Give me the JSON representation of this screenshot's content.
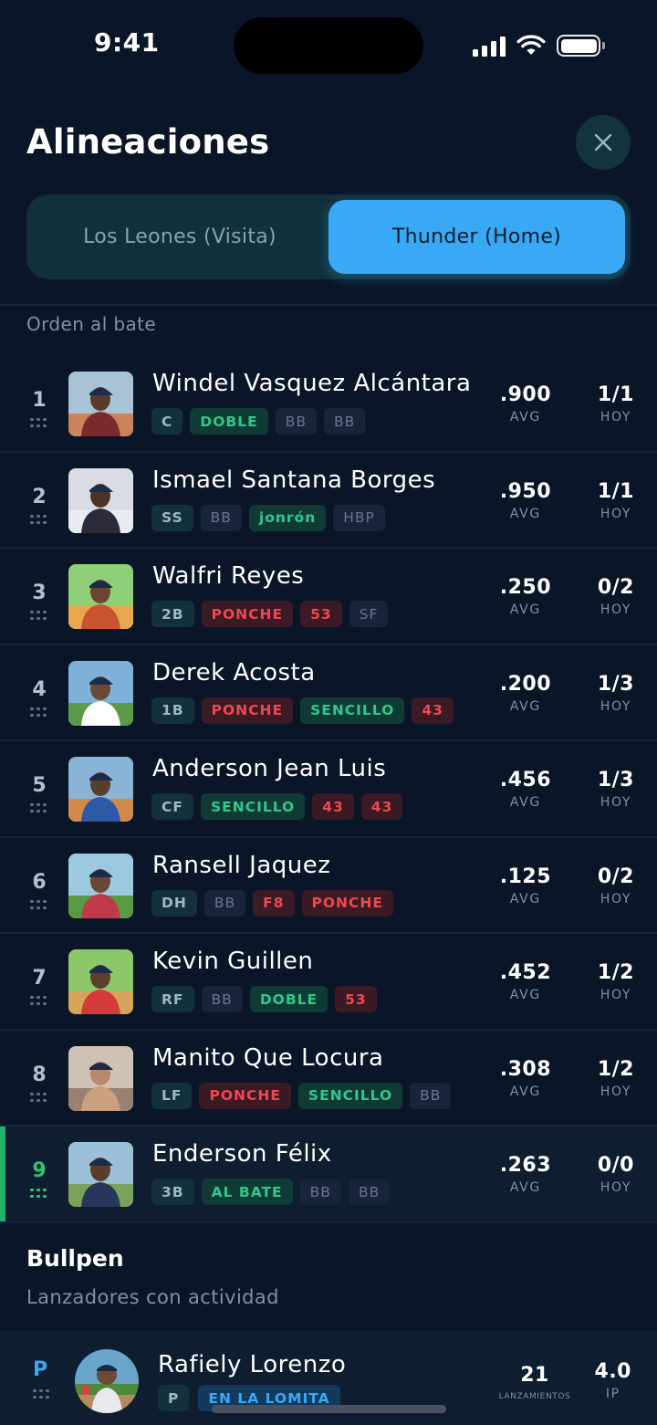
{
  "status_bar": {
    "time": "9:41"
  },
  "header": {
    "title": "Alineaciones"
  },
  "tabs": [
    {
      "label": "Los Leones (Visita)",
      "selected": false
    },
    {
      "label": "Thunder (Home)",
      "selected": true
    }
  ],
  "lineup": {
    "section_label": "Orden al bate",
    "stat_labels": {
      "avg": "AVG",
      "today": "HOY"
    },
    "players": [
      {
        "order": "1",
        "name": "Windel Vasquez Alcántara",
        "position": "C",
        "events": [
          {
            "text": "DOBLE",
            "kind": "green"
          },
          {
            "text": "BB",
            "kind": "neutral"
          },
          {
            "text": "BB",
            "kind": "neutral"
          }
        ],
        "avg": ".900",
        "today": "1/1",
        "active": false
      },
      {
        "order": "2",
        "name": "Ismael Santana Borges",
        "position": "SS",
        "events": [
          {
            "text": "BB",
            "kind": "neutral"
          },
          {
            "text": "jonrón",
            "kind": "green"
          },
          {
            "text": "HBP",
            "kind": "neutral"
          }
        ],
        "avg": ".950",
        "today": "1/1",
        "active": false
      },
      {
        "order": "3",
        "name": "Walfri Reyes",
        "position": "2B",
        "events": [
          {
            "text": "PONCHE",
            "kind": "red"
          },
          {
            "text": "53",
            "kind": "red"
          },
          {
            "text": "SF",
            "kind": "neutral"
          }
        ],
        "avg": ".250",
        "today": "0/2",
        "active": false
      },
      {
        "order": "4",
        "name": "Derek Acosta",
        "position": "1B",
        "events": [
          {
            "text": "PONCHE",
            "kind": "red"
          },
          {
            "text": "SENCILLO",
            "kind": "green"
          },
          {
            "text": "43",
            "kind": "red"
          }
        ],
        "avg": ".200",
        "today": "1/3",
        "active": false
      },
      {
        "order": "5",
        "name": "Anderson Jean Luis",
        "position": "CF",
        "events": [
          {
            "text": "SENCILLO",
            "kind": "green"
          },
          {
            "text": "43",
            "kind": "red"
          },
          {
            "text": "43",
            "kind": "red"
          }
        ],
        "avg": ".456",
        "today": "1/3",
        "active": false
      },
      {
        "order": "6",
        "name": "Ransell Jaquez",
        "position": "DH",
        "events": [
          {
            "text": "BB",
            "kind": "neutral"
          },
          {
            "text": "F8",
            "kind": "red"
          },
          {
            "text": "PONCHE",
            "kind": "red"
          }
        ],
        "avg": ".125",
        "today": "0/2",
        "active": false
      },
      {
        "order": "7",
        "name": "Kevin Guillen",
        "position": "RF",
        "events": [
          {
            "text": "BB",
            "kind": "neutral"
          },
          {
            "text": "DOBLE",
            "kind": "green"
          },
          {
            "text": "53",
            "kind": "red"
          }
        ],
        "avg": ".452",
        "today": "1/2",
        "active": false
      },
      {
        "order": "8",
        "name": "Manito Que Locura",
        "position": "LF",
        "events": [
          {
            "text": "PONCHE",
            "kind": "red"
          },
          {
            "text": "SENCILLO",
            "kind": "green"
          },
          {
            "text": "BB",
            "kind": "neutral"
          }
        ],
        "avg": ".308",
        "today": "1/2",
        "active": false
      },
      {
        "order": "9",
        "name": "Enderson Félix",
        "position": "3B",
        "events": [
          {
            "text": "AL BATE",
            "kind": "green"
          },
          {
            "text": "BB",
            "kind": "neutral"
          },
          {
            "text": "BB",
            "kind": "neutral"
          }
        ],
        "avg": ".263",
        "today": "0/0",
        "active": true
      }
    ]
  },
  "bullpen": {
    "title": "Bullpen",
    "subtitle": "Lanzadores con actividad",
    "pitchers": [
      {
        "role": "P",
        "name": "Rafiely Lorenzo",
        "position": "P",
        "status": "EN LA LOMITA",
        "pitches": "21",
        "pitches_label": "LANZAMIENTOS",
        "ip": "4.0",
        "ip_label": "IP"
      }
    ]
  },
  "colors": {
    "background": "#0b1528",
    "accent_blue": "#3aa9f5",
    "accent_green": "#2ec46f",
    "danger_red": "#f0474f"
  }
}
